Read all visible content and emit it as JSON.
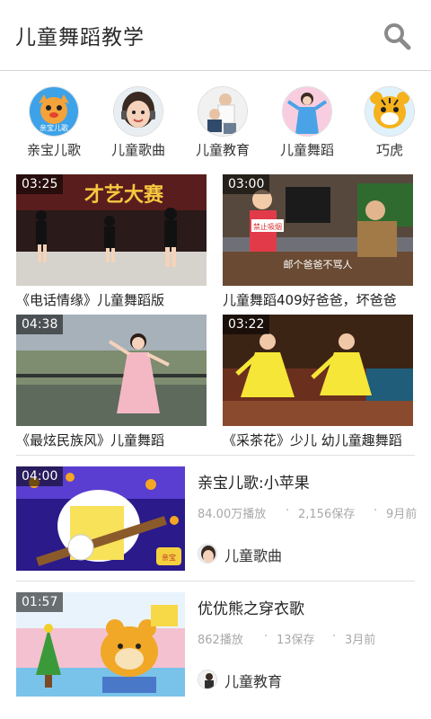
{
  "header": {
    "title": "儿童舞蹈教学",
    "search_icon": "search-icon"
  },
  "categories": [
    {
      "label": "亲宝儿歌",
      "badge": "亲宝儿歌"
    },
    {
      "label": "儿童歌曲"
    },
    {
      "label": "儿童教育"
    },
    {
      "label": "儿童舞蹈"
    },
    {
      "label": "巧虎"
    }
  ],
  "grid": [
    {
      "duration": "03:25",
      "title": "《电话情缘》儿童舞蹈版",
      "overlay": "才艺大赛"
    },
    {
      "duration": "03:00",
      "title": "儿童舞蹈409好爸爸，坏爸爸",
      "overlay": "邮个爸爸不骂人",
      "sign": "禁止吸烟"
    },
    {
      "duration": "04:38",
      "title": "《最炫民族风》儿童舞蹈"
    },
    {
      "duration": "03:22",
      "title": "《采茶花》少儿 幼儿童趣舞蹈"
    }
  ],
  "list": [
    {
      "duration": "04:00",
      "title": "亲宝儿歌:小苹果",
      "plays": "84.00万播放",
      "saves": "2,156保存",
      "age": "9月前",
      "channel": "儿童歌曲",
      "logo": "亲宝"
    },
    {
      "duration": "01:57",
      "title": "优优熊之穿衣歌",
      "plays": "862播放",
      "saves": "13保存",
      "age": "3月前",
      "channel": "儿童教育"
    }
  ],
  "colors": {
    "divider": "#e0e0e0",
    "meta": "#a8a8a8",
    "duration_bg": "rgba(0,0,0,0.55)"
  }
}
